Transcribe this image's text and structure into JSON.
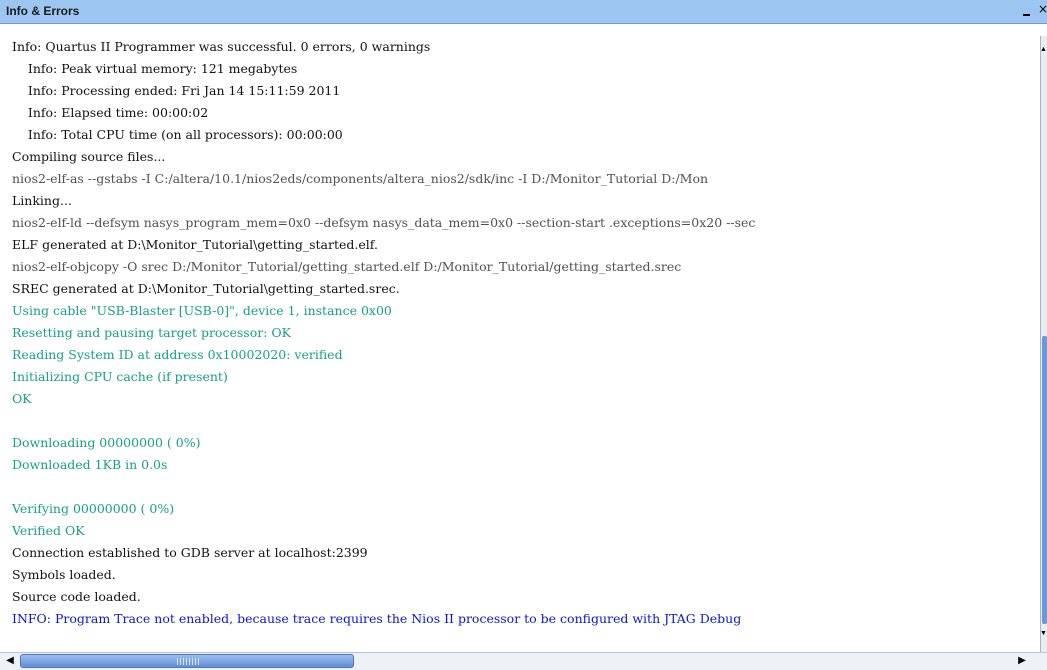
{
  "panel": {
    "title": "Info & Errors",
    "minimize_icon": "minimize-icon",
    "close_icon": "close-icon"
  },
  "log": [
    {
      "text": "Info: Quartus II Programmer was successful. 0 errors, 0 warnings",
      "color": "#111111"
    },
    {
      "text": "    Info: Peak virtual memory: 121 megabytes",
      "color": "#111111"
    },
    {
      "text": "    Info: Processing ended: Fri Jan 14 15:11:59 2011",
      "color": "#111111"
    },
    {
      "text": "    Info: Elapsed time: 00:00:02",
      "color": "#111111"
    },
    {
      "text": "    Info: Total CPU time (on all processors): 00:00:00",
      "color": "#111111"
    },
    {
      "text": "Compiling source files...",
      "color": "#111111"
    },
    {
      "text": "nios2-elf-as --gstabs -I C:/altera/10.1/nios2eds/components/altera_nios2/sdk/inc -I D:/Monitor_Tutorial D:/Mon",
      "color": "#505050"
    },
    {
      "text": "Linking...",
      "color": "#111111"
    },
    {
      "text": "nios2-elf-ld --defsym nasys_program_mem=0x0 --defsym nasys_data_mem=0x0 --section-start .exceptions=0x20 --sec",
      "color": "#505050"
    },
    {
      "text": "ELF generated at D:\\Monitor_Tutorial\\getting_started.elf.",
      "color": "#111111"
    },
    {
      "text": "nios2-elf-objcopy -O srec D:/Monitor_Tutorial/getting_started.elf D:/Monitor_Tutorial/getting_started.srec",
      "color": "#505050"
    },
    {
      "text": "SREC generated at D:\\Monitor_Tutorial\\getting_started.srec.",
      "color": "#111111"
    },
    {
      "text": "Using cable \"USB-Blaster [USB-0]\", device 1, instance 0x00",
      "color": "#15a089"
    },
    {
      "text": "Resetting and pausing target processor: OK",
      "color": "#15a089"
    },
    {
      "text": "Reading System ID at address 0x10002020: verified",
      "color": "#15a089"
    },
    {
      "text": "Initializing CPU cache (if present)",
      "color": "#15a089"
    },
    {
      "text": "OK",
      "color": "#15a089"
    },
    {
      "text": "",
      "color": "#111111"
    },
    {
      "text": "Downloading 00000000 ( 0%)",
      "color": "#15a089"
    },
    {
      "text": "Downloaded 1KB in 0.0s",
      "color": "#15a089"
    },
    {
      "text": "",
      "color": "#111111"
    },
    {
      "text": "Verifying 00000000 ( 0%)",
      "color": "#15a089"
    },
    {
      "text": "Verified OK",
      "color": "#15a089"
    },
    {
      "text": "Connection established to GDB server at localhost:2399",
      "color": "#111111"
    },
    {
      "text": "Symbols loaded.",
      "color": "#111111"
    },
    {
      "text": "Source code loaded.",
      "color": "#111111"
    },
    {
      "text": "INFO: Program Trace not enabled, because trace requires the Nios II processor to be configured with JTAG Debug",
      "color": "#0b14d6"
    }
  ],
  "scrollbars": {
    "vertical_up_icon": "scroll-up-arrow-icon",
    "vertical_down_icon": "scroll-down-arrow-icon",
    "horizontal_left_icon": "scroll-left-arrow-icon",
    "horizontal_right_icon": "scroll-right-arrow-icon"
  }
}
